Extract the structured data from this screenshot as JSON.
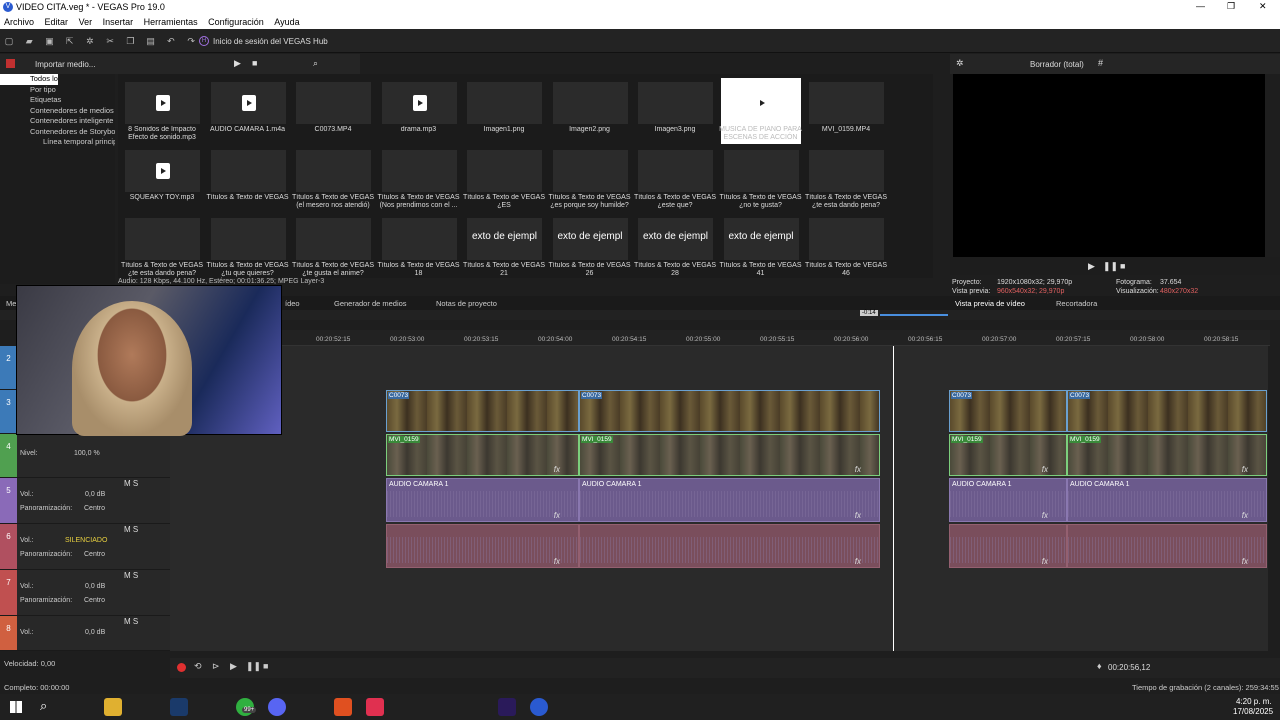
{
  "window": {
    "title": "VIDEO CITA.veg * - VEGAS Pro 19.0",
    "controls": [
      "—",
      "❐",
      "✕"
    ]
  },
  "menu": [
    "Archivo",
    "Editar",
    "Ver",
    "Insertar",
    "Herramientas",
    "Configuración",
    "Ayuda"
  ],
  "toolbar": {
    "hub": "Inicio de sesión del VEGAS Hub"
  },
  "explorer": {
    "import": "Importar medio...",
    "tree": [
      "Todos los medios",
      "Por tipo",
      "Etiquetas",
      "Contenedores de medios",
      "Contenedores inteligente",
      "Contenedores de Storybo",
      "Línea temporal princip"
    ]
  },
  "media": [
    {
      "name": "8 Sonidos de Impacto Efecto de sonido.mp3",
      "kind": "doc"
    },
    {
      "name": "AUDIO CAMARA 1.m4a",
      "kind": "doc"
    },
    {
      "name": "C0073.MP4",
      "kind": "photo"
    },
    {
      "name": "drama.mp3",
      "kind": "doc"
    },
    {
      "name": "Imagen1.png",
      "kind": "photo"
    },
    {
      "name": "Imagen2.png",
      "kind": "photo"
    },
    {
      "name": "Imagen3.png",
      "kind": "photo"
    },
    {
      "name": "MUSICA DE PIANO PARA ESCENAS DE ACCIÓN",
      "kind": "docsel"
    },
    {
      "name": "MVI_0159.MP4",
      "kind": "photo"
    },
    {
      "name": "SQUEAKY TOY.mp3",
      "kind": "doc"
    },
    {
      "name": "Títulos & Texto de VEGAS",
      "kind": "checker"
    },
    {
      "name": "Títulos & Texto de VEGAS (el mesero nos atendió)",
      "kind": "checker"
    },
    {
      "name": "Títulos & Texto de VEGAS (Nos prendimos con el ...",
      "kind": "checker"
    },
    {
      "name": "Títulos & Texto de VEGAS ¿ES",
      "kind": "checker"
    },
    {
      "name": "Títulos & Texto de VEGAS ¿es porque soy humilde?",
      "kind": "checker"
    },
    {
      "name": "Títulos & Texto de VEGAS ¿este que?",
      "kind": "checker"
    },
    {
      "name": "Títulos & Texto de VEGAS ¿no te gusta?",
      "kind": "checker"
    },
    {
      "name": "Títulos & Texto de VEGAS ¿te esta dando pena?",
      "kind": "checker"
    },
    {
      "name": "Títulos & Texto de VEGAS ¿te esta dando pena?",
      "kind": "checker"
    },
    {
      "name": "Títulos & Texto de VEGAS ¿tu que quieres?",
      "kind": "checker"
    },
    {
      "name": "Títulos & Texto de VEGAS ¿te gusta el anime?",
      "kind": "checker"
    },
    {
      "name": "Títulos & Texto de VEGAS 18",
      "kind": "checker"
    },
    {
      "name": "Títulos & Texto de VEGAS 21",
      "kind": "text",
      "overlay": "exto de ejempl"
    },
    {
      "name": "Títulos & Texto de VEGAS 26",
      "kind": "text",
      "overlay": "exto de ejempl"
    },
    {
      "name": "Títulos & Texto de VEGAS 28",
      "kind": "text",
      "overlay": "exto de ejempl"
    },
    {
      "name": "Títulos & Texto de VEGAS 41",
      "kind": "text",
      "overlay": "exto de ejempl"
    },
    {
      "name": "Títulos & Texto de VEGAS 46",
      "kind": "checker"
    }
  ],
  "media_status": "Audio: 128 Kbps, 44.100 Hz, Estéreo; 00:01:36.25; MPEG Layer-3",
  "preview": {
    "mode": "Borrador (total)",
    "project_label": "Proyecto:",
    "project": "1920x1080x32; 29,970p",
    "vista_label": "Vista previa:",
    "vista": "960x540x32; 29,970p",
    "frame_label": "Fotograma:",
    "frame": "37.654",
    "vis_label": "Visualización:",
    "vis": "480x270x32"
  },
  "tabs": {
    "left": [
      "Me",
      "ídeo",
      "Generador de medios",
      "Notas de proyecto"
    ],
    "right": [
      "Vista previa de vídeo",
      "Recortadora"
    ]
  },
  "ruler": {
    "cursor": "-0:14",
    "ticks": [
      "00:20:52:15",
      "00:20:53:00",
      "00:20:53:15",
      "00:20:54:00",
      "00:20:54:15",
      "00:20:55:00",
      "00:20:55:15",
      "00:20:56:00",
      "00:20:56:15",
      "00:20:57:00",
      "00:20:57:15",
      "00:20:58:00",
      "00:20:58:15"
    ]
  },
  "tracks": [
    {
      "num": "2",
      "color": "#3c7ab8"
    },
    {
      "num": "3",
      "color": "#3c7ab8"
    },
    {
      "num": "4",
      "color": "#50a050",
      "level_label": "Nivel:",
      "level": "100,0 %"
    },
    {
      "num": "5",
      "color": "#8a6ab8",
      "vol_label": "Vol.:",
      "vol": "0,0 dB",
      "pan_label": "Panoramización:",
      "pan": "Centro"
    },
    {
      "num": "6",
      "color": "#b05060",
      "vol_label": "Vol.:",
      "vol": "SILENCIADO",
      "pan_label": "Panoramización:",
      "pan": "Centro"
    },
    {
      "num": "7",
      "color": "#c05050",
      "vol_label": "Vol.:",
      "vol": "0,0 dB",
      "pan_label": "Panoramización:",
      "pan": "Centro"
    },
    {
      "num": "8",
      "color": "#d06040",
      "vol_label": "Vol.:",
      "vol": "0,0 dB"
    }
  ],
  "clips": {
    "v1": "C0073",
    "v2": "MVI_0159",
    "a1": "AUDIO CAMARA 1"
  },
  "speed": "Velocidad: 0,00",
  "timecode": "00:20:56,12",
  "status": {
    "left": "Completo: 00:00:00",
    "right": "Tiempo de grabación (2 canales): 259:34:55"
  },
  "taskbar": {
    "time": "4:20 p. m.",
    "date": "17/08/2025",
    "badge": "99+"
  },
  "colors": {
    "accent": "#3c7ab8",
    "video_border": "#6aa0d0",
    "audio": "#6b5a8c"
  }
}
